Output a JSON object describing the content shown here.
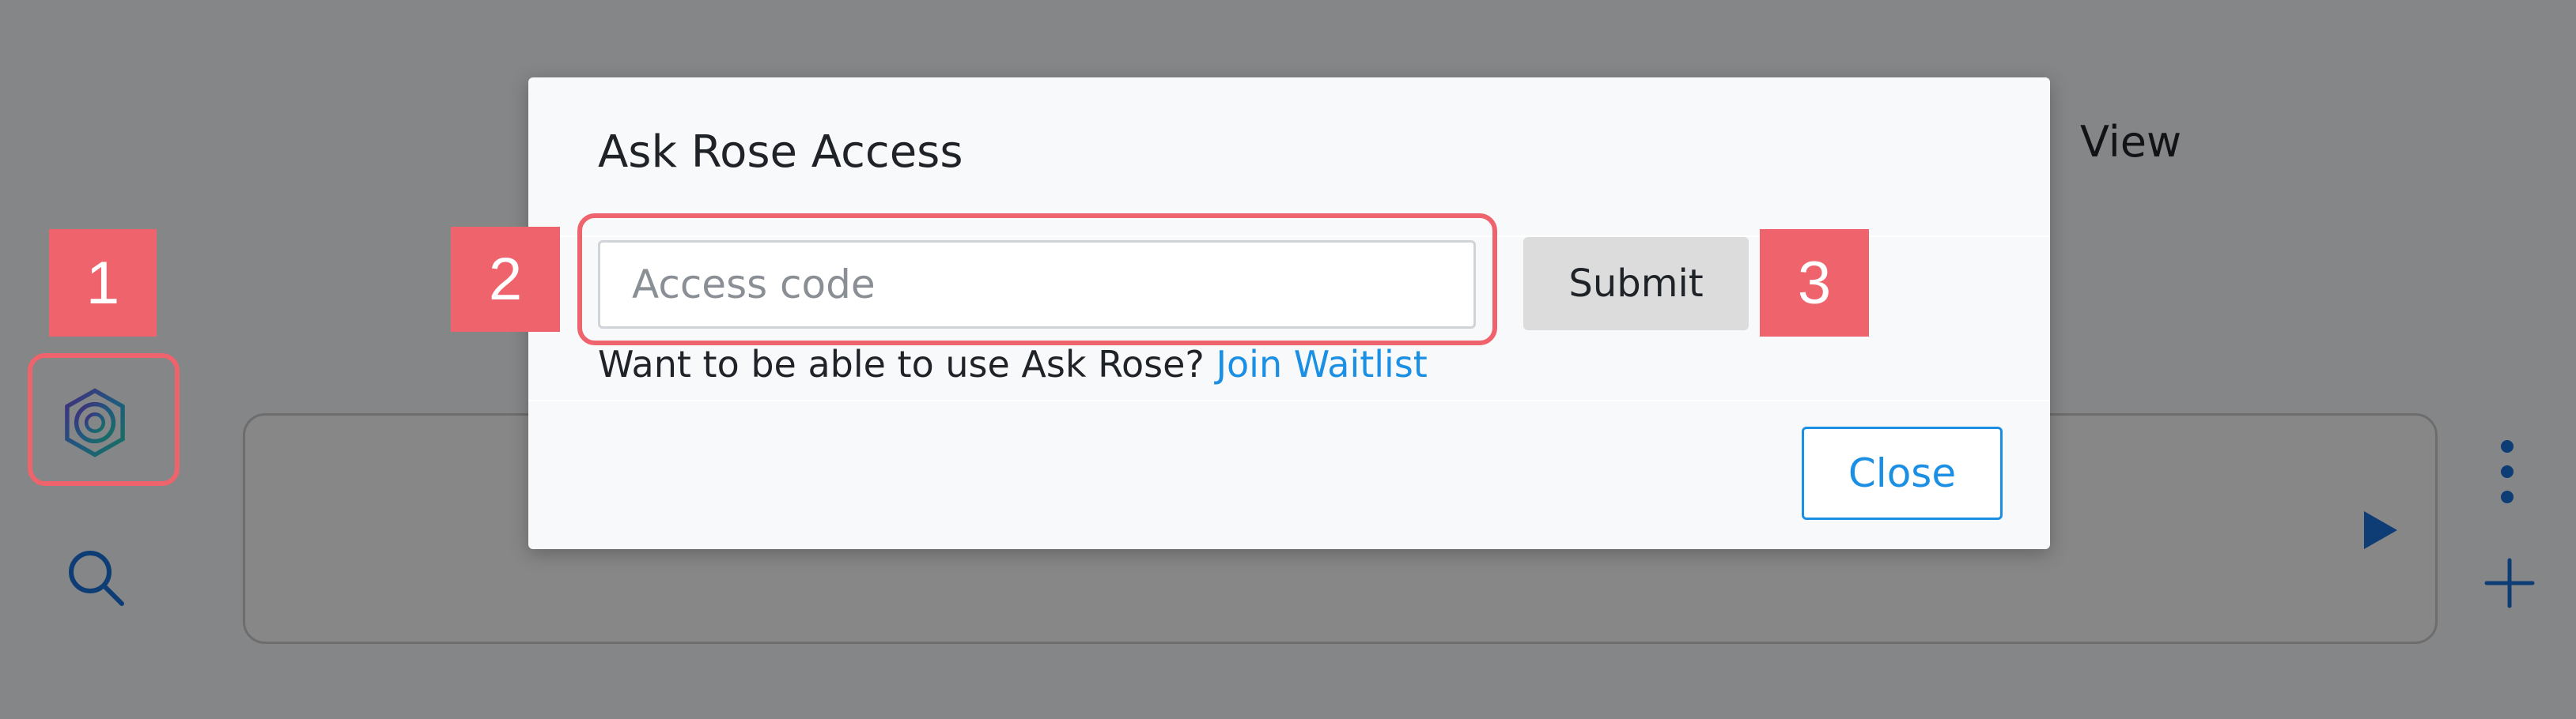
{
  "background_app": {
    "view_label": "View"
  },
  "modal": {
    "title": "Ask Rose Access",
    "access_input": {
      "value": "",
      "placeholder": "Access code"
    },
    "submit_label": "Submit",
    "waitlist_prompt": "Want to be able to use Ask Rose?",
    "waitlist_link": "Join Waitlist",
    "close_label": "Close"
  },
  "annotations": {
    "logo_callout": "1",
    "input_callout": "2",
    "submit_callout": "3",
    "color": "#ef636c"
  },
  "colors": {
    "accent": "#1a8fe3",
    "overlay": "rgba(0,0,0,0.45)"
  },
  "icons": [
    "rose-logo-icon",
    "search-icon",
    "run-icon",
    "more-vertical-icon",
    "add-icon"
  ]
}
